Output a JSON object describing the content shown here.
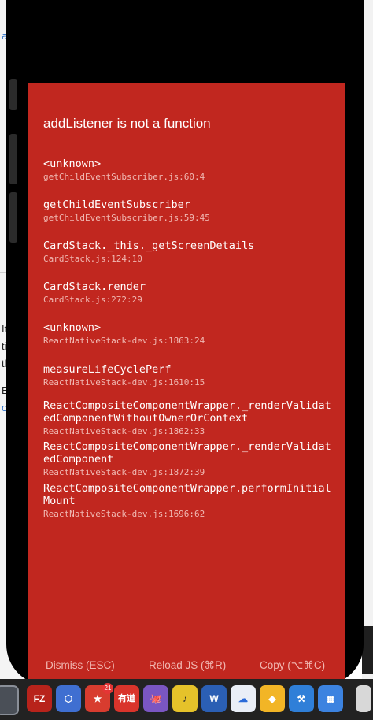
{
  "background_window": {
    "top_label": "ar",
    "fragments": [
      "It",
      "ti",
      "th",
      "B",
      "c"
    ]
  },
  "error": {
    "title": "addListener is not a function",
    "frames": [
      {
        "fn": "<unknown>",
        "loc": "getChildEventSubscriber.js:60:4"
      },
      {
        "fn": "getChildEventSubscriber",
        "loc": "getChildEventSubscriber.js:59:45"
      },
      {
        "fn": "CardStack._this._getScreenDetails",
        "loc": "CardStack.js:124:10"
      },
      {
        "fn": "CardStack.render",
        "loc": "CardStack.js:272:29"
      },
      {
        "fn": "<unknown>",
        "loc": "ReactNativeStack-dev.js:1863:24"
      },
      {
        "fn": "measureLifeCyclePerf",
        "loc": "ReactNativeStack-dev.js:1610:15"
      },
      {
        "fn": "ReactCompositeComponentWrapper._renderValidatedComponentWithoutOwnerOrContext",
        "loc": "ReactNativeStack-dev.js:1862:33"
      },
      {
        "fn": "ReactCompositeComponentWrapper._renderValidatedComponent",
        "loc": "ReactNativeStack-dev.js:1872:39"
      },
      {
        "fn": "ReactCompositeComponentWrapper.performInitialMount",
        "loc": "ReactNativeStack-dev.js:1696:62"
      }
    ]
  },
  "footer": {
    "dismiss": "Dismiss (ESC)",
    "reload": "Reload JS (⌘R)",
    "copy": "Copy (⌥⌘C)"
  },
  "colors": {
    "redbox": "#c1271f",
    "footer_text": "#f1b7b1",
    "location_text": "#f0b8b2"
  },
  "dock": {
    "items": [
      {
        "name": "finder-window",
        "icon": "window-icon",
        "label": ""
      },
      {
        "name": "filezilla",
        "icon": "filezilla-icon",
        "label": "FZ"
      },
      {
        "name": "browser",
        "icon": "hexagon-icon",
        "label": "⬡"
      },
      {
        "name": "wunderlist",
        "icon": "star-icon",
        "label": "★",
        "badge": "21"
      },
      {
        "name": "youdao",
        "icon": "youdao-icon",
        "label": "有道"
      },
      {
        "name": "github",
        "icon": "github-icon",
        "label": "🐙"
      },
      {
        "name": "music",
        "icon": "music-icon",
        "label": "♪"
      },
      {
        "name": "word",
        "icon": "word-icon",
        "label": "W"
      },
      {
        "name": "baidu-cloud",
        "icon": "cloud-icon",
        "label": "☁"
      },
      {
        "name": "sketch",
        "icon": "sketch-icon",
        "label": "◆"
      },
      {
        "name": "xcode",
        "icon": "xcode-icon",
        "label": "⚒"
      },
      {
        "name": "simulator",
        "icon": "simulator-icon",
        "label": "▦"
      },
      {
        "name": "document",
        "icon": "document-icon",
        "label": ""
      }
    ]
  }
}
